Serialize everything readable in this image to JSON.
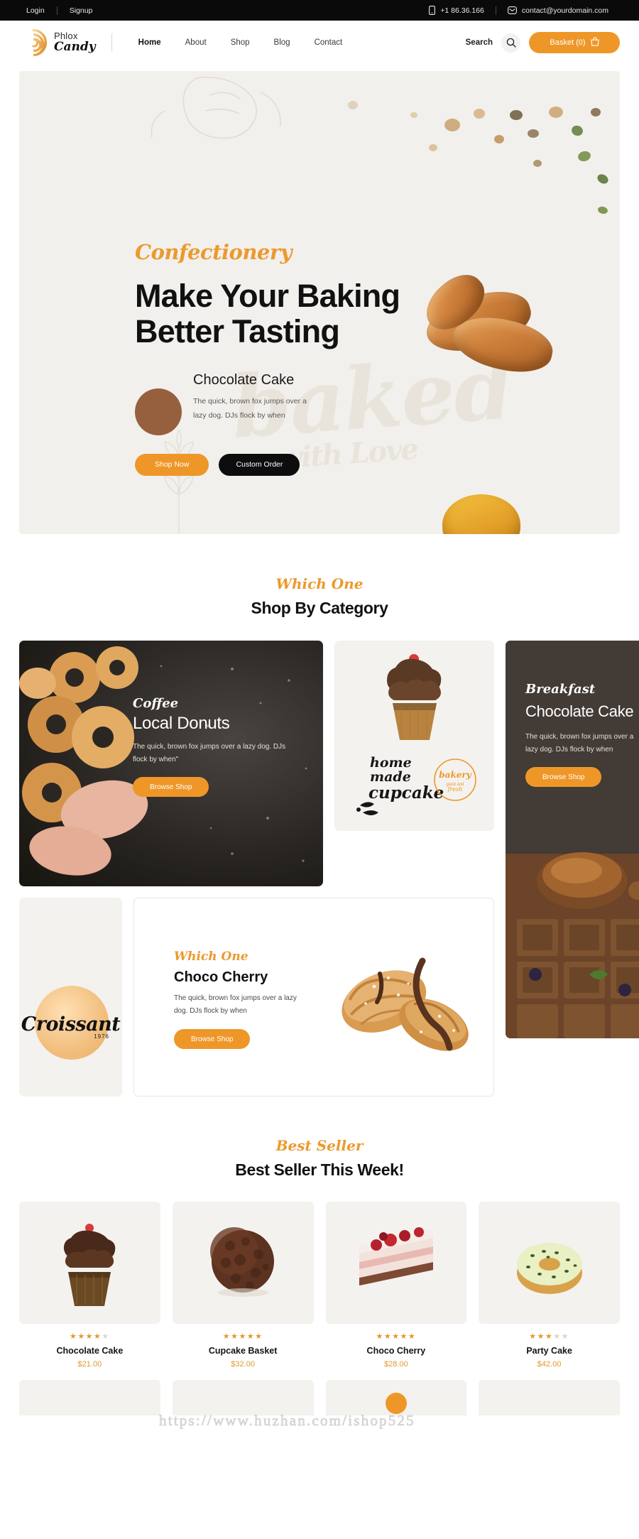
{
  "topbar": {
    "login": "Login",
    "signup": "Signup",
    "phone": "+1 86.36.166",
    "email": "contact@yourdomain.com",
    "phone_icon": "mobile-icon",
    "email_icon": "envelope-icon"
  },
  "header": {
    "brand_line1": "Phlox",
    "brand_line2": "Candy",
    "nav": [
      {
        "label": "Home",
        "active": true
      },
      {
        "label": "About",
        "active": false
      },
      {
        "label": "Shop",
        "active": false
      },
      {
        "label": "Blog",
        "active": false
      },
      {
        "label": "Contact",
        "active": false
      }
    ],
    "search_label": "Search",
    "search_icon": "search-icon",
    "basket_label": "Basket (0)",
    "basket_icon": "basket-icon",
    "basket_count": "0"
  },
  "hero": {
    "eyebrow": "Confectionery",
    "title": "Make Your Baking Better Tasting",
    "watermark": "baked",
    "watermark_sub": "with Love",
    "sub_title": "Chocolate Cake",
    "sub_desc": "The quick, brown fox jumps over a lazy dog. DJs flock by when",
    "btn_primary": "Shop Now",
    "btn_secondary": "Custom Order"
  },
  "category_section": {
    "eyebrow": "Which One",
    "title": "Shop By Category",
    "cards": [
      {
        "id": "local-donuts",
        "eyebrow": "Coffee",
        "title": "Local Donuts",
        "desc": "The quick, brown fox jumps over a lazy dog. DJs flock by when\"",
        "button": "Browse Shop"
      },
      {
        "id": "home-made-cupcake",
        "label_line1": "home",
        "label_line2": "made",
        "label_line3": "cupcake",
        "badge_line1": "bakery",
        "badge_line2": "good and fresh"
      },
      {
        "id": "breakfast-chocolate-cake",
        "eyebrow": "Breakfast",
        "title": "Chocolate Cake",
        "desc": "The quick, brown fox jumps over a lazy dog. DJs flock by when",
        "button": "Browse Shop"
      },
      {
        "id": "croissant",
        "word": "Croissant",
        "number": "1976"
      },
      {
        "id": "choco-cherry",
        "eyebrow": "Which One",
        "title": "Choco Cherry",
        "desc": "The quick, brown fox jumps over a lazy dog. DJs flock by when",
        "button": "Browse Shop"
      }
    ]
  },
  "bestseller_section": {
    "eyebrow": "Best Seller",
    "title": "Best Seller This Week!",
    "products": [
      {
        "name": "Chocolate Cake",
        "price": "$21.00",
        "rating": 4,
        "max_rating": 5,
        "thumb": "chocolate-cupcake"
      },
      {
        "name": "Cupcake Basket",
        "price": "$32.00",
        "rating": 5,
        "max_rating": 5,
        "thumb": "chocolate-truffle"
      },
      {
        "name": "Choco Cherry",
        "price": "$28.00",
        "rating": 5,
        "max_rating": 5,
        "thumb": "cherry-slice"
      },
      {
        "name": "Party Cake",
        "price": "$42.00",
        "rating": 3,
        "max_rating": 5,
        "thumb": "pistachio-donut"
      }
    ]
  },
  "watermark": {
    "url": "https://www.huzhan.com/ishop525"
  },
  "colors": {
    "accent": "#ee9728",
    "accent_text": "#eb9a2e",
    "dark": "#0a0a0a",
    "hero_bg": "#f2f0ec",
    "card_bg": "#f4f2ee"
  }
}
